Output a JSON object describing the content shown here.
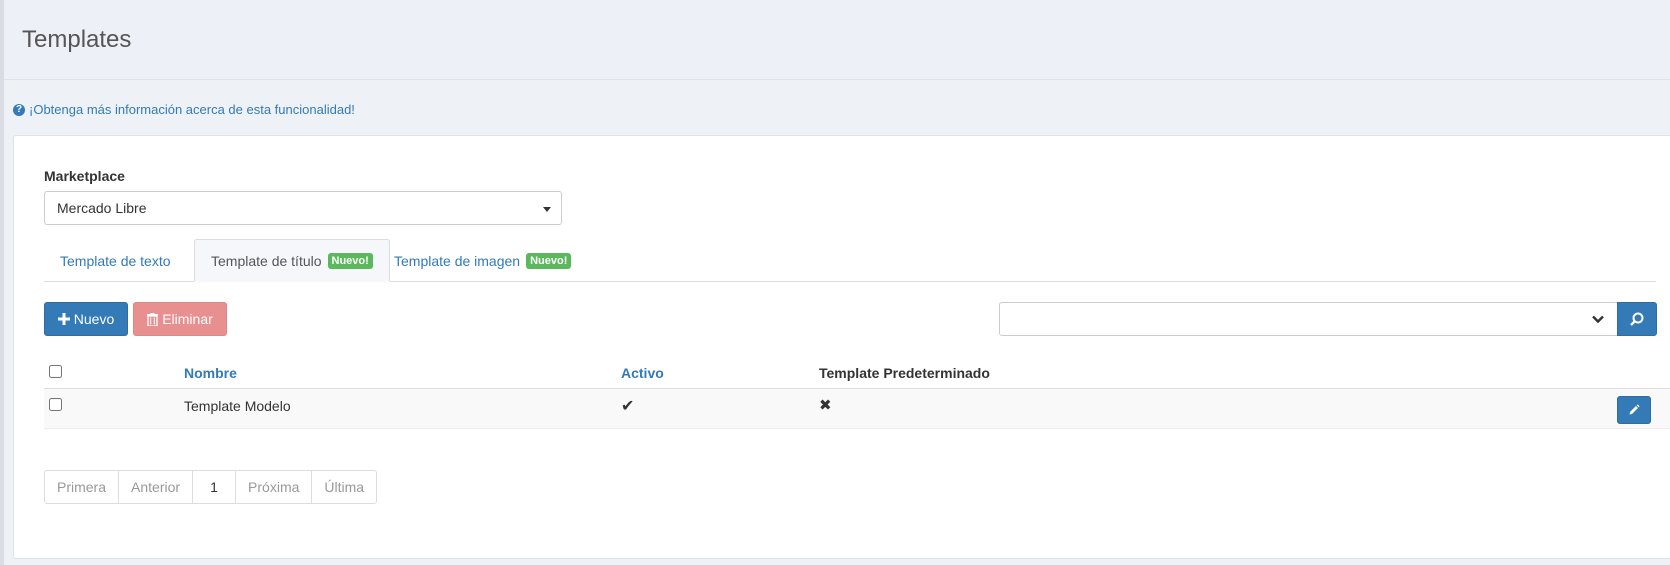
{
  "page": {
    "title": "Templates"
  },
  "help": {
    "icon": "question-circle-icon",
    "text": "¡Obtenga más información acerca de esta funcionalidad!"
  },
  "marketplace": {
    "label": "Marketplace",
    "selected": "Mercado Libre"
  },
  "tabs": [
    {
      "label": "Template de texto",
      "active": false,
      "badge": ""
    },
    {
      "label": "Template de título",
      "active": true,
      "badge": "Nuevo!"
    },
    {
      "label": "Template de imagen",
      "active": false,
      "badge": "Nuevo!"
    }
  ],
  "toolbar": {
    "new_label": "Nuevo",
    "delete_label": "Eliminar"
  },
  "search": {
    "placeholder": "",
    "value": ""
  },
  "table": {
    "columns": [
      "Nombre",
      "Activo",
      "Template Predeterminado"
    ],
    "rows": [
      {
        "name": "Template Modelo",
        "active": "✔",
        "default": "✖"
      }
    ]
  },
  "pagination": {
    "first": "Primera",
    "prev": "Anterior",
    "current": "1",
    "next": "Próxima",
    "last": "Última"
  },
  "colors": {
    "primary": "#337ab7",
    "danger": "#e8908f",
    "badge": "#5cb85c"
  }
}
